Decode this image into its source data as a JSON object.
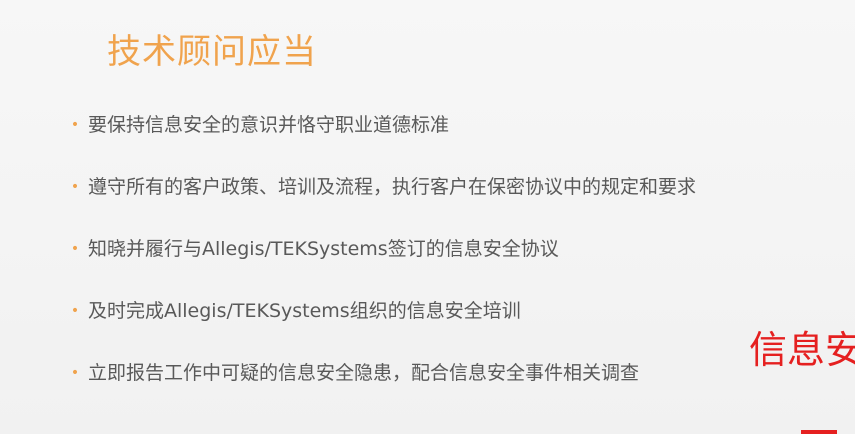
{
  "slide": {
    "title": "技术顾问应当",
    "bullet_symbol": "•",
    "bullets": [
      "要保持信息安全的意识并恪守职业道德标准",
      "遵守所有的客户政策、培训及流程，执行客户在保密协议中的规定和要求",
      "知晓并履行与Allegis/TEKSystems签订的信息安全协议",
      "及时完成Allegis/TEKSystems组织的信息安全培训",
      "立即报告工作中可疑的信息安全隐患，配合信息安全事件相关调查"
    ],
    "side_text": "信息安",
    "colors": {
      "accent": "#f0a34d",
      "body_text": "#595959",
      "red_text": "#e52020",
      "background": "#f3f3f3"
    }
  }
}
